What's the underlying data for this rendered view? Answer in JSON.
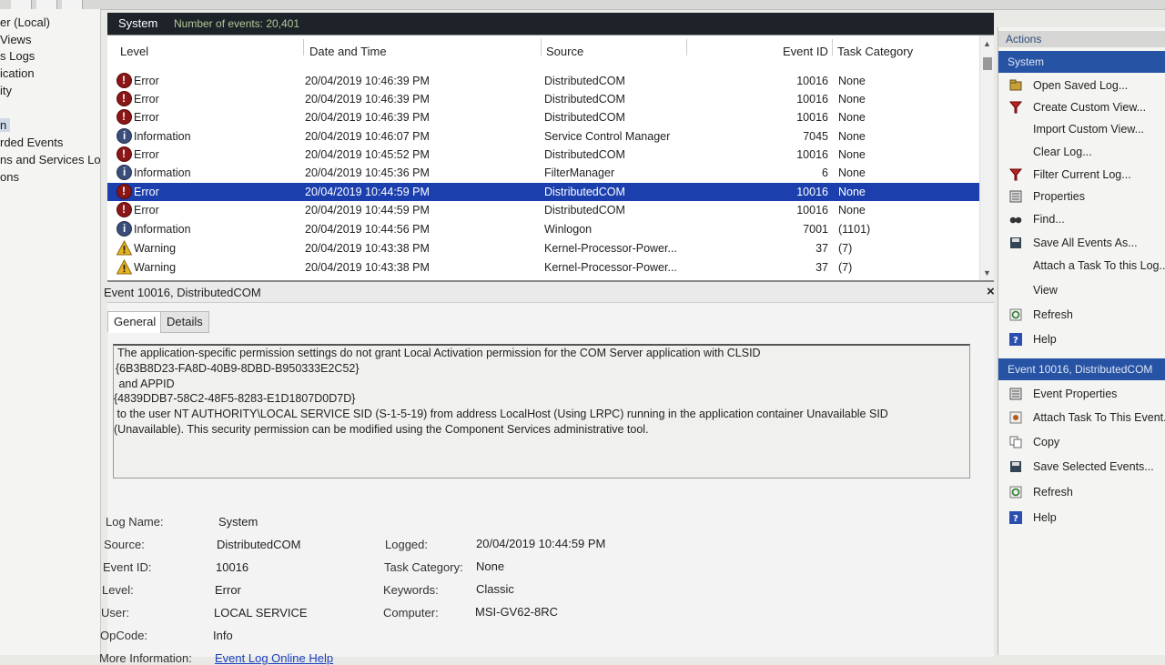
{
  "tree": {
    "items": [
      "er (Local)",
      " Views",
      "s Logs",
      "ication",
      "ity",
      "n",
      "rded Events",
      "ns and Services Lo",
      "ons"
    ]
  },
  "log_header": {
    "title": "System",
    "count_label": "Number of events: 20,401"
  },
  "grid": {
    "columns": {
      "level": "Level",
      "datetime": "Date and Time",
      "source": "Source",
      "event_id": "Event ID",
      "task_category": "Task Category"
    },
    "rows": [
      {
        "level": "Error",
        "datetime": "20/04/2019 10:46:39 PM",
        "source": "DistributedCOM",
        "event_id": "10016",
        "task_category": "None"
      },
      {
        "level": "Error",
        "datetime": "20/04/2019 10:46:39 PM",
        "source": "DistributedCOM",
        "event_id": "10016",
        "task_category": "None"
      },
      {
        "level": "Error",
        "datetime": "20/04/2019 10:46:39 PM",
        "source": "DistributedCOM",
        "event_id": "10016",
        "task_category": "None"
      },
      {
        "level": "Information",
        "datetime": "20/04/2019 10:46:07 PM",
        "source": "Service Control Manager",
        "event_id": "7045",
        "task_category": "None"
      },
      {
        "level": "Error",
        "datetime": "20/04/2019 10:45:52 PM",
        "source": "DistributedCOM",
        "event_id": "10016",
        "task_category": "None"
      },
      {
        "level": "Information",
        "datetime": "20/04/2019 10:45:36 PM",
        "source": "FilterManager",
        "event_id": "6",
        "task_category": "None"
      },
      {
        "level": "Error",
        "datetime": "20/04/2019 10:44:59 PM",
        "source": "DistributedCOM",
        "event_id": "10016",
        "task_category": "None"
      },
      {
        "level": "Error",
        "datetime": "20/04/2019 10:44:59 PM",
        "source": "DistributedCOM",
        "event_id": "10016",
        "task_category": "None"
      },
      {
        "level": "Information",
        "datetime": "20/04/2019 10:44:56 PM",
        "source": "Winlogon",
        "event_id": "7001",
        "task_category": "(1101)"
      },
      {
        "level": "Warning",
        "datetime": "20/04/2019 10:43:38 PM",
        "source": "Kernel-Processor-Power...",
        "event_id": "37",
        "task_category": "(7)"
      },
      {
        "level": "Warning",
        "datetime": "20/04/2019 10:43:38 PM",
        "source": "Kernel-Processor-Power...",
        "event_id": "37",
        "task_category": "(7)"
      }
    ]
  },
  "detail": {
    "title": "Event 10016, DistributedCOM",
    "tabs": [
      "General",
      "Details"
    ],
    "message_lines": [
      "The application-specific permission settings do not grant Local Activation permission for the COM Server application with CLSID",
      "{6B3B8D23-FA8D-40B9-8DBD-B950333E2C52}",
      " and APPID",
      "{4839DDB7-58C2-48F5-8283-E1D1807D0D7D}",
      " to the user NT AUTHORITY\\LOCAL SERVICE SID (S-1-5-19) from address LocalHost (Using LRPC) running in the application container Unavailable SID",
      "(Unavailable). This security permission can be modified using the Component Services administrative tool."
    ],
    "props": {
      "log_name_k": "Log Name:",
      "log_name_v": "System",
      "source_k": "Source:",
      "source_v": "DistributedCOM",
      "logged_k": "Logged:",
      "logged_v": "20/04/2019 10:44:59 PM",
      "event_id_k": "Event ID:",
      "event_id_v": "10016",
      "task_cat_k": "Task Category:",
      "task_cat_v": "None",
      "level_k": "Level:",
      "level_v": "Error",
      "keywords_k": "Keywords:",
      "keywords_v": "Classic",
      "user_k": "User:",
      "user_v": "LOCAL SERVICE",
      "computer_k": "Computer:",
      "computer_v": "MSI-GV62-8RC",
      "opcode_k": "OpCode:",
      "opcode_v": "Info",
      "more_info_k": "More Information:",
      "more_info_v": "Event Log Online Help"
    }
  },
  "actions": {
    "header": "Actions",
    "section1": "System",
    "items1": [
      {
        "label": "Open Saved Log...",
        "icon": "open-log-icon"
      },
      {
        "label": "Create Custom View...",
        "icon": "filter-icon"
      },
      {
        "label": "Import Custom View...",
        "icon": ""
      },
      {
        "label": "Clear Log...",
        "icon": ""
      },
      {
        "label": "Filter Current Log...",
        "icon": "filter-icon"
      },
      {
        "label": "Properties",
        "icon": "properties-icon"
      },
      {
        "label": "Find...",
        "icon": "find-icon"
      },
      {
        "label": "Save All Events As...",
        "icon": "save-icon"
      },
      {
        "label": "Attach a Task To this Log...",
        "icon": ""
      },
      {
        "label": "View",
        "icon": ""
      },
      {
        "label": "Refresh",
        "icon": "refresh-icon"
      },
      {
        "label": "Help",
        "icon": "help-icon"
      }
    ],
    "section2": "Event 10016, DistributedCOM",
    "items2": [
      {
        "label": "Event Properties",
        "icon": "properties-icon"
      },
      {
        "label": "Attach Task To This Event...",
        "icon": "attach-task-icon"
      },
      {
        "label": "Copy",
        "icon": "copy-icon"
      },
      {
        "label": "Save Selected Events...",
        "icon": "save-icon"
      },
      {
        "label": "Refresh",
        "icon": "refresh-icon"
      },
      {
        "label": "Help",
        "icon": "help-icon"
      }
    ]
  },
  "colors": {
    "selection": "#1c3fae",
    "header_bg": "#1d2329",
    "action_section": "#2753a4",
    "link": "#1a3fbf"
  }
}
